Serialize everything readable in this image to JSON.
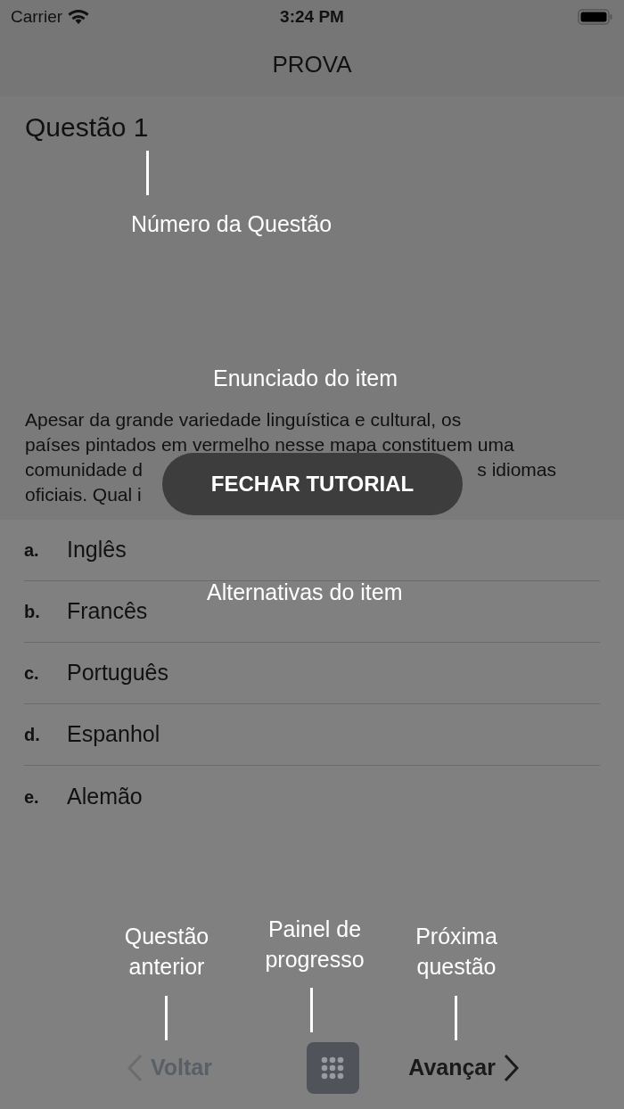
{
  "status_bar": {
    "carrier": "Carrier",
    "time": "3:24 PM"
  },
  "nav_bar": {
    "title": "PROVA"
  },
  "question": {
    "number": "Questão 1",
    "statement_lines": [
      {
        "left": "Apesar da grande variedade linguística e cultural, os"
      },
      {
        "left": "países pintados em vermelho nesse mapa constituem uma"
      },
      {
        "left": "comunidade d",
        "right": "s idiomas"
      },
      {
        "left": "oficiais. Qual i"
      }
    ]
  },
  "alternatives": [
    {
      "letter": "a.",
      "text": "Inglês"
    },
    {
      "letter": "b.",
      "text": "Francês"
    },
    {
      "letter": "c.",
      "text": "Português"
    },
    {
      "letter": "d.",
      "text": "Espanhol"
    },
    {
      "letter": "e.",
      "text": "Alemão"
    }
  ],
  "toolbar": {
    "back": {
      "label": "Voltar",
      "disabled": true
    },
    "next": {
      "label": "Avançar",
      "disabled": false
    }
  },
  "tutorial": {
    "close_button": "FECHAR TUTORIAL",
    "annotations": [
      {
        "text": "Número da Questão",
        "kind": "number"
      },
      {
        "text": "Enunciado do item",
        "kind": "statement"
      },
      {
        "text": "Alternativas do item",
        "kind": "alternatives"
      },
      {
        "text": "Questão anterior",
        "kind": "back"
      },
      {
        "text": "Painel de progresso",
        "kind": "panel"
      },
      {
        "text": "Próxima questão",
        "kind": "next"
      }
    ]
  }
}
